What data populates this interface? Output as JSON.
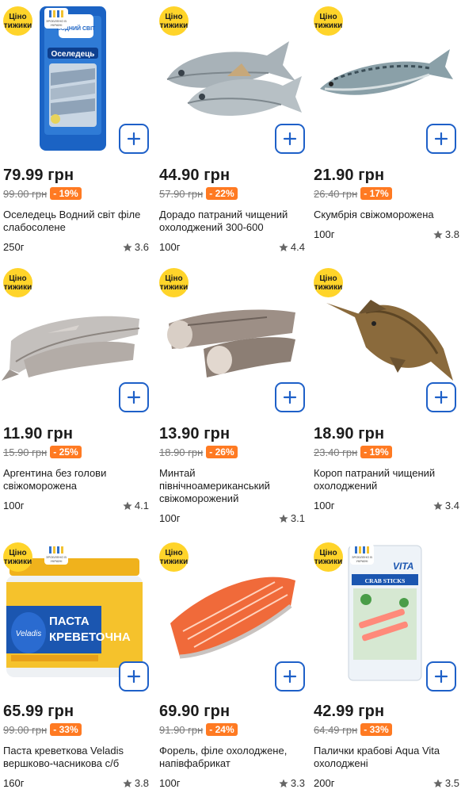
{
  "badge": {
    "line1": "Ціно",
    "line2": "тижики"
  },
  "made_in_ua": "ЗРОБЛЕНО В УКРАЇНІ",
  "products": [
    {
      "price": "79.99 грн",
      "old_price": "99.00 грн",
      "discount": "- 19%",
      "name": "Оселедець Водний світ філе слабосолене",
      "weight": "250г",
      "rating": "3.6",
      "image": "herring-fillet-pack",
      "made_in_ua": true,
      "pack_brand": "ВОДНИЙ СВІТ",
      "pack_label": "Оселедець"
    },
    {
      "price": "44.90 грн",
      "old_price": "57.90 грн",
      "discount": "- 22%",
      "name": "Дорадо патраний чищений охолоджений 300-600",
      "weight": "100г",
      "rating": "4.4",
      "image": "dorado-fish"
    },
    {
      "price": "21.90 грн",
      "old_price": "26.40 грн",
      "discount": "- 17%",
      "name": "Скумбрія свіжоморожена",
      "weight": "100г",
      "rating": "3.8",
      "image": "mackerel-fish"
    },
    {
      "price": "11.90 грн",
      "old_price": "15.90 грн",
      "discount": "- 25%",
      "name": "Аргентина без голови свіжоморожена",
      "weight": "100г",
      "rating": "4.1",
      "image": "argentina-fish"
    },
    {
      "price": "13.90 грн",
      "old_price": "18.90 грн",
      "discount": "- 26%",
      "name": "Минтай північноамериканський свіжоморожений",
      "weight": "100г",
      "rating": "3.1",
      "image": "pollock-fish"
    },
    {
      "price": "18.90 грн",
      "old_price": "23.40 грн",
      "discount": "- 19%",
      "name": "Короп патраний чищений охолоджений",
      "weight": "100г",
      "rating": "3.4",
      "image": "carp-fish"
    },
    {
      "price": "65.99 грн",
      "old_price": "99.00 грн",
      "discount": "- 33%",
      "name": "Паста креветкова Veladis вершково-часникова с/б",
      "weight": "160г",
      "rating": "3.8",
      "image": "shrimp-paste-jar",
      "made_in_ua": true,
      "jar_brand": "Veladis",
      "jar_text1": "ПАСТА",
      "jar_text2": "КРЕВЕТОЧНА"
    },
    {
      "price": "69.90 грн",
      "old_price": "91.90 грн",
      "discount": "- 24%",
      "name": "Форель, філе охолоджене, напівфабрикат",
      "weight": "100г",
      "rating": "3.3",
      "image": "trout-fillet"
    },
    {
      "price": "42.99 грн",
      "old_price": "64.49 грн",
      "discount": "- 33%",
      "name": "Палички крабові Aqua Vita охолоджені",
      "weight": "200г",
      "rating": "3.5",
      "image": "crab-sticks-pack",
      "made_in_ua": true,
      "pack_brand": "VITA",
      "pack_label": "CRAB STICKS"
    }
  ],
  "colors": {
    "accent": "#1e60c8",
    "badge": "#ffd42a",
    "discount": "#ff7a22",
    "old_price": "#7a7a7a"
  },
  "icons": {
    "add": "plus-icon",
    "rating": "star-icon"
  }
}
